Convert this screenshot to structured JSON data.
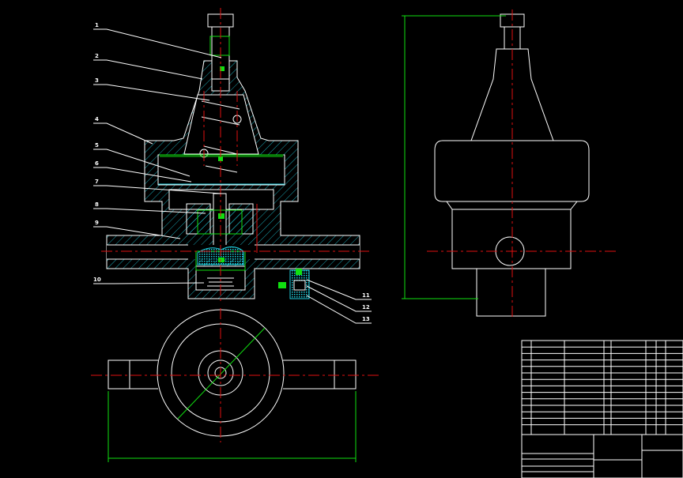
{
  "drawing": {
    "part_labels_left": [
      "1",
      "2",
      "3",
      "4",
      "5",
      "6",
      "7",
      "8",
      "9",
      "10"
    ],
    "part_labels_right": [
      "11",
      "12",
      "13"
    ],
    "colors": {
      "background": "#000000",
      "outline": "#ffffff",
      "centerline": "#e01010",
      "dimension": "#10e010",
      "hatch": "#20d0e0"
    }
  }
}
